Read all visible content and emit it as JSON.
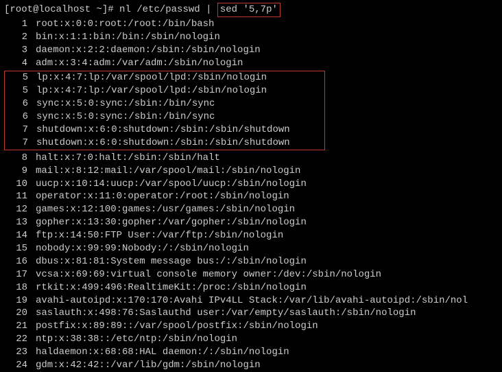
{
  "prompt": {
    "user_host": "[root@localhost ~]#",
    "cmd_part1": "nl /etc/passwd | ",
    "cmd_highlight": "sed '5,7p'"
  },
  "lines_before": [
    {
      "n": "1",
      "t": "root:x:0:0:root:/root:/bin/bash"
    },
    {
      "n": "2",
      "t": "bin:x:1:1:bin:/bin:/sbin/nologin"
    },
    {
      "n": "3",
      "t": "daemon:x:2:2:daemon:/sbin:/sbin/nologin"
    },
    {
      "n": "4",
      "t": "adm:x:3:4:adm:/var/adm:/sbin/nologin"
    }
  ],
  "lines_highlight": [
    {
      "n": "5",
      "t": "lp:x:4:7:lp:/var/spool/lpd:/sbin/nologin"
    },
    {
      "n": "5",
      "t": "lp:x:4:7:lp:/var/spool/lpd:/sbin/nologin"
    },
    {
      "n": "6",
      "t": "sync:x:5:0:sync:/sbin:/bin/sync"
    },
    {
      "n": "6",
      "t": "sync:x:5:0:sync:/sbin:/bin/sync"
    },
    {
      "n": "7",
      "t": "shutdown:x:6:0:shutdown:/sbin:/sbin/shutdown"
    },
    {
      "n": "7",
      "t": "shutdown:x:6:0:shutdown:/sbin:/sbin/shutdown"
    }
  ],
  "lines_after": [
    {
      "n": "8",
      "t": "halt:x:7:0:halt:/sbin:/sbin/halt"
    },
    {
      "n": "9",
      "t": "mail:x:8:12:mail:/var/spool/mail:/sbin/nologin"
    },
    {
      "n": "10",
      "t": "uucp:x:10:14:uucp:/var/spool/uucp:/sbin/nologin"
    },
    {
      "n": "11",
      "t": "operator:x:11:0:operator:/root:/sbin/nologin"
    },
    {
      "n": "12",
      "t": "games:x:12:100:games:/usr/games:/sbin/nologin"
    },
    {
      "n": "13",
      "t": "gopher:x:13:30:gopher:/var/gopher:/sbin/nologin"
    },
    {
      "n": "14",
      "t": "ftp:x:14:50:FTP User:/var/ftp:/sbin/nologin"
    },
    {
      "n": "15",
      "t": "nobody:x:99:99:Nobody:/:/sbin/nologin"
    },
    {
      "n": "16",
      "t": "dbus:x:81:81:System message bus:/:/sbin/nologin"
    },
    {
      "n": "17",
      "t": "vcsa:x:69:69:virtual console memory owner:/dev:/sbin/nologin"
    },
    {
      "n": "18",
      "t": "rtkit:x:499:496:RealtimeKit:/proc:/sbin/nologin"
    },
    {
      "n": "19",
      "t": "avahi-autoipd:x:170:170:Avahi IPv4LL Stack:/var/lib/avahi-autoipd:/sbin/nol"
    },
    {
      "n": "20",
      "t": "saslauth:x:498:76:Saslauthd user:/var/empty/saslauth:/sbin/nologin"
    },
    {
      "n": "21",
      "t": "postfix:x:89:89::/var/spool/postfix:/sbin/nologin"
    },
    {
      "n": "22",
      "t": "ntp:x:38:38::/etc/ntp:/sbin/nologin"
    },
    {
      "n": "23",
      "t": "haldaemon:x:68:68:HAL daemon:/:/sbin/nologin"
    },
    {
      "n": "24",
      "t": "gdm:x:42:42::/var/lib/gdm:/sbin/nologin"
    }
  ]
}
